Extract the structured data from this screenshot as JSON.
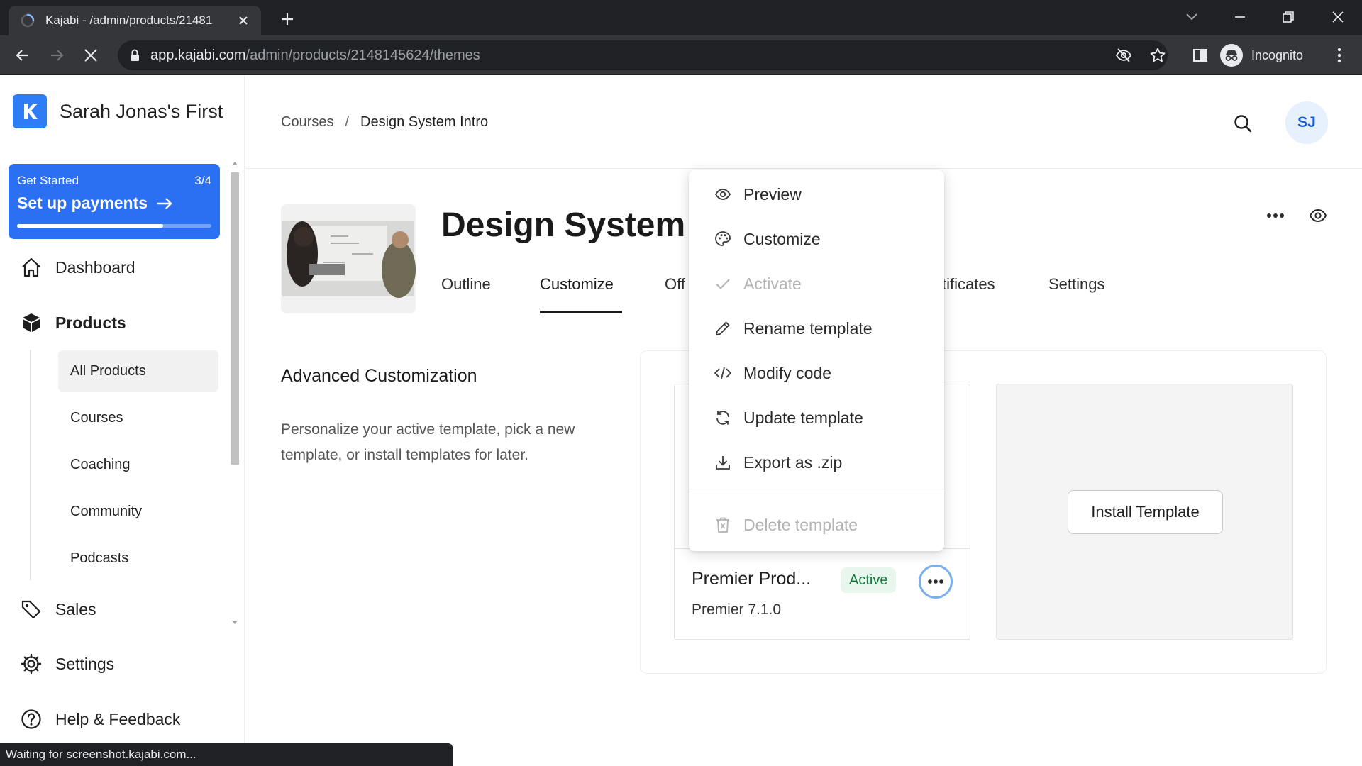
{
  "browser": {
    "tab_title": "Kajabi - /admin/products/21481",
    "url_host": "app.kajabi.com",
    "url_path": "/admin/products/2148145624/themes",
    "incognito_label": "Incognito",
    "status_text": "Waiting for screenshot.kajabi.com..."
  },
  "sidebar": {
    "brand_name": "Sarah Jonas's First",
    "get_started": {
      "label": "Get Started",
      "progress_text": "3/4",
      "action": "Set up payments",
      "progress": 0.75
    },
    "nav": {
      "dashboard": "Dashboard",
      "products": "Products",
      "sales": "Sales",
      "settings": "Settings",
      "help": "Help & Feedback"
    },
    "products_sub": [
      "All Products",
      "Courses",
      "Coaching",
      "Community",
      "Podcasts"
    ]
  },
  "header": {
    "breadcrumb": [
      "Courses",
      "/",
      "Design System Intro"
    ],
    "avatar_initials": "SJ"
  },
  "product": {
    "title": "Design System Intro",
    "tabs": [
      "Outline",
      "Customize",
      "Off",
      "tificates",
      "Settings"
    ],
    "active_tab": "Customize"
  },
  "content": {
    "section_title": "Advanced Customization",
    "section_desc": "Personalize your active template, pick a new template, or install templates for later.",
    "template": {
      "name": "Premier Prod...",
      "badge": "Active",
      "version": "Premier 7.1.0"
    },
    "install_label": "Install Template"
  },
  "menu": {
    "items": [
      {
        "label": "Preview",
        "icon": "eye-icon",
        "disabled": false
      },
      {
        "label": "Customize",
        "icon": "palette-icon",
        "disabled": false
      },
      {
        "label": "Activate",
        "icon": "check-icon",
        "disabled": true
      },
      {
        "label": "Rename template",
        "icon": "pencil-icon",
        "disabled": false
      },
      {
        "label": "Modify code",
        "icon": "code-icon",
        "disabled": false
      },
      {
        "label": "Update template",
        "icon": "refresh-icon",
        "disabled": false
      },
      {
        "label": "Export as .zip",
        "icon": "download-icon",
        "disabled": false
      },
      {
        "label": "Delete template",
        "icon": "trash-icon",
        "disabled": true
      }
    ]
  },
  "colors": {
    "brand_blue": "#2b6ff3",
    "active_badge_bg": "#e8f6ee",
    "active_badge_text": "#137a3c",
    "disabled_text": "#b3b3b3"
  }
}
